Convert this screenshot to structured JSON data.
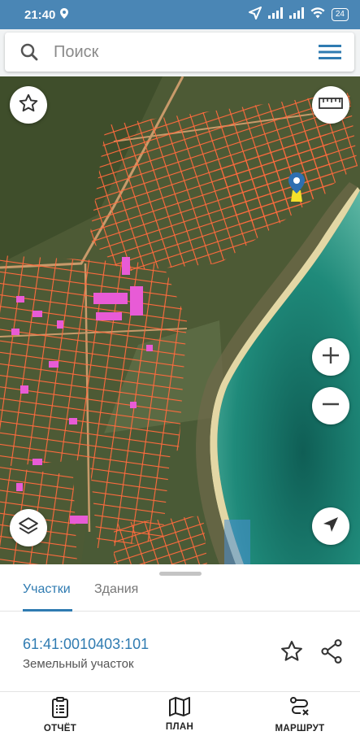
{
  "status": {
    "time": "21:40",
    "battery": "24"
  },
  "search": {
    "placeholder": "Поиск"
  },
  "tabs": [
    {
      "label": "Участки"
    },
    {
      "label": "Здания"
    }
  ],
  "parcel": {
    "cadastral_number": "61:41:0010403:101",
    "type": "Земельный участок"
  },
  "bottom_nav": [
    {
      "label": "ОТЧЁТ"
    },
    {
      "label": "ПЛАН"
    },
    {
      "label": "МАРШРУТ"
    }
  ],
  "colors": {
    "accent": "#2f7bb1",
    "status_bar": "#4a86b5",
    "parcel_outline": "#ff6a3d",
    "building": "#e85bd6",
    "marker": "#2f6fb1",
    "sea": "#1f8a7a"
  },
  "icons": [
    "location-icon",
    "navigation-arrow-icon",
    "signal-icon",
    "wifi-icon",
    "search-icon",
    "menu-icon",
    "star-icon",
    "ruler-icon",
    "zoom-in-icon",
    "zoom-out-icon",
    "layers-icon",
    "my-location-icon",
    "share-icon",
    "clipboard-icon",
    "map-icon",
    "route-icon"
  ]
}
